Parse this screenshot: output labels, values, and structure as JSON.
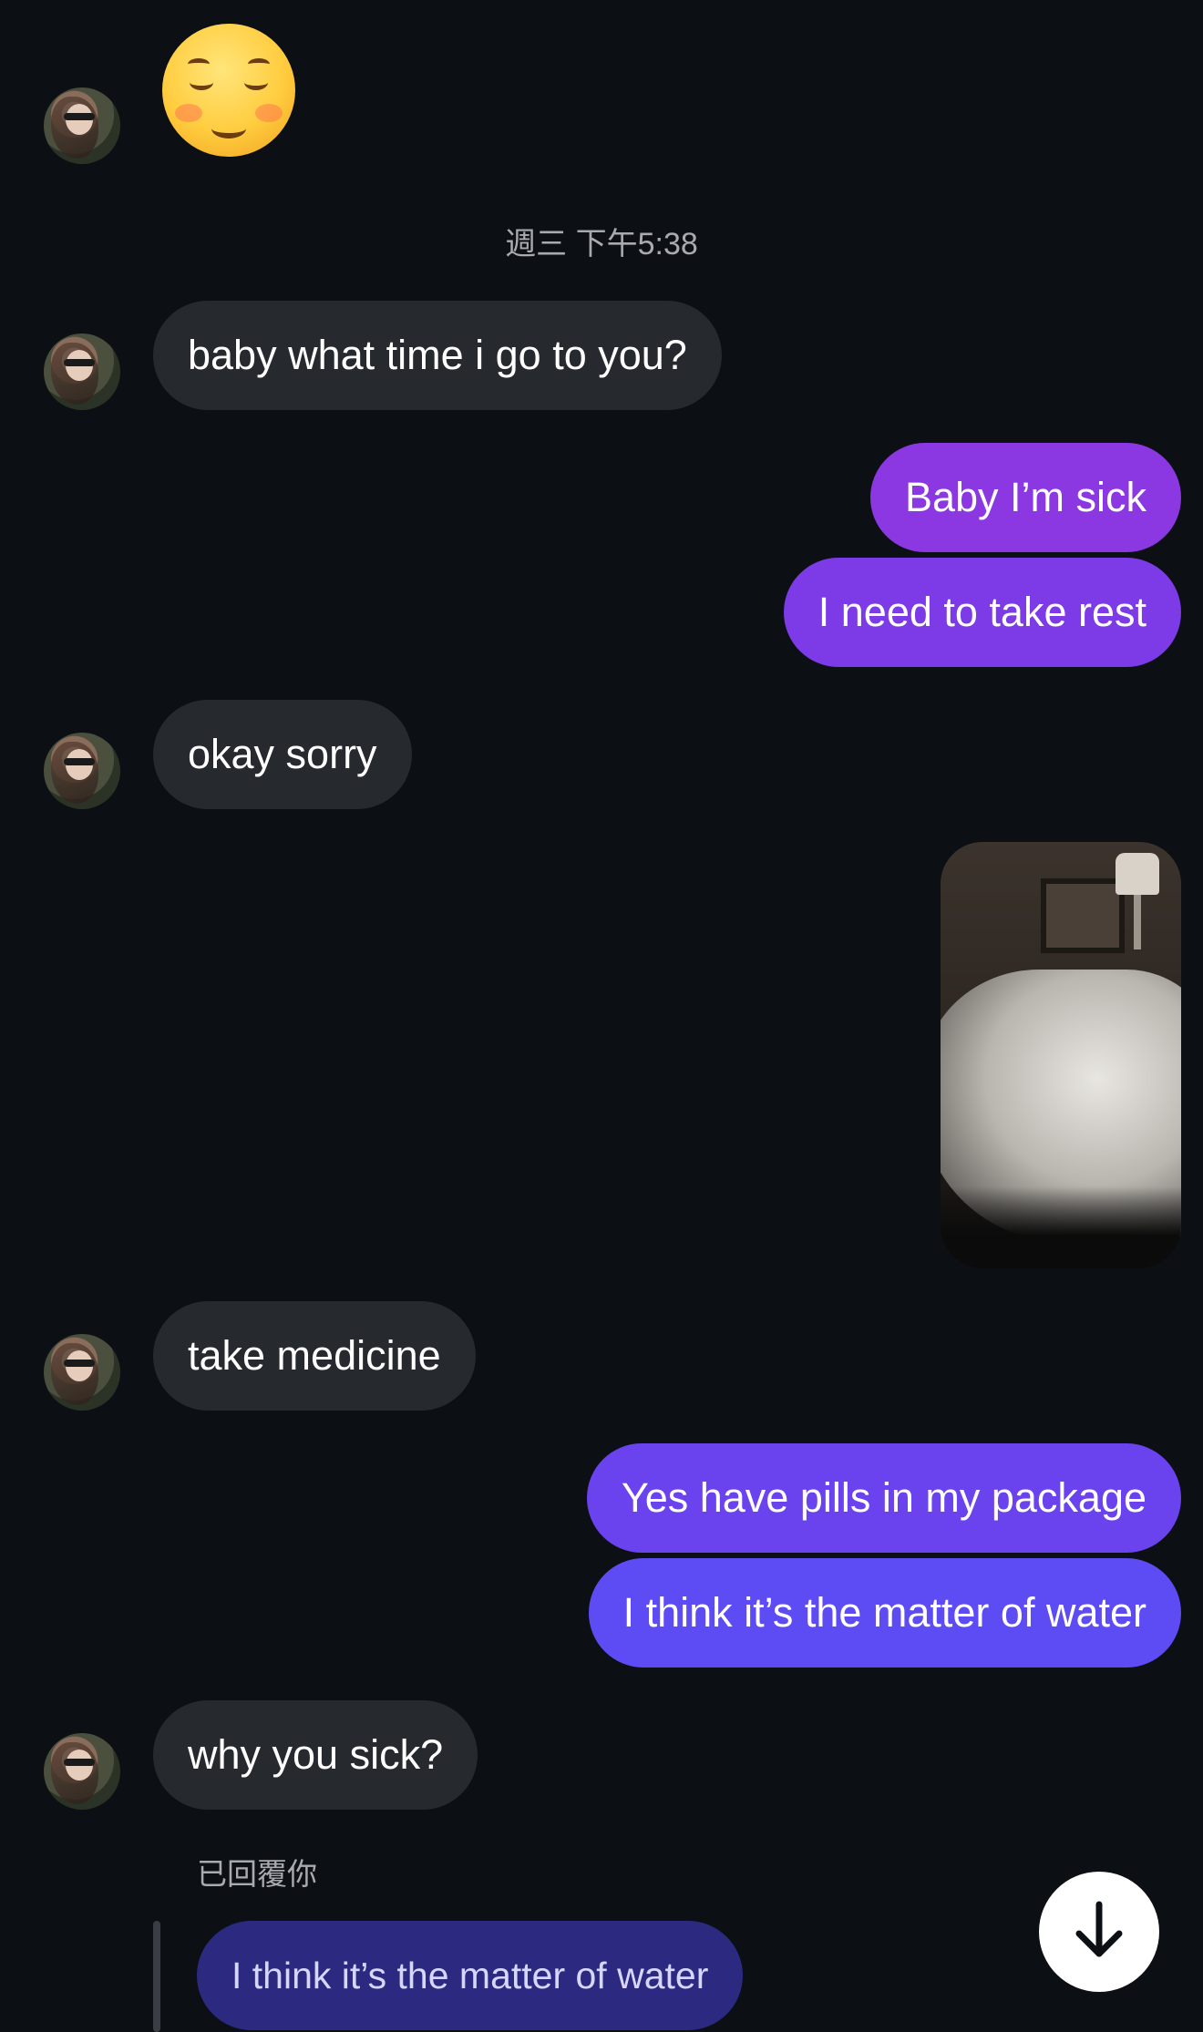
{
  "timestamp": "週三 下午5:38",
  "reaction_emoji": "smiling-face-with-blush-emoji",
  "messages": [
    {
      "from": "them",
      "text": "baby what time i go to you?"
    },
    {
      "from": "me",
      "text": "Baby I’m sick"
    },
    {
      "from": "me",
      "text": "I need to take rest"
    },
    {
      "from": "them",
      "text": "okay sorry"
    },
    {
      "from": "me",
      "type": "photo",
      "subject": "bed-with-white-sheets"
    },
    {
      "from": "them",
      "text": "take medicine"
    },
    {
      "from": "me",
      "text": "Yes have pills in my package"
    },
    {
      "from": "me",
      "text": "I think it’s the matter of water"
    },
    {
      "from": "them",
      "text": "why you sick?"
    }
  ],
  "reply": {
    "label": "已回覆你",
    "quoted_text": "I think it’s the matter of water"
  },
  "colors": {
    "background": "#0c1014",
    "incoming_bubble": "#26292e",
    "outgoing_gradient": [
      "#9137e0",
      "#7a3be5",
      "#6a42ee",
      "#5a4cf3"
    ],
    "reply_bubble": "#2c2a80"
  },
  "icons": {
    "scroll_down": "arrow-down-icon"
  }
}
